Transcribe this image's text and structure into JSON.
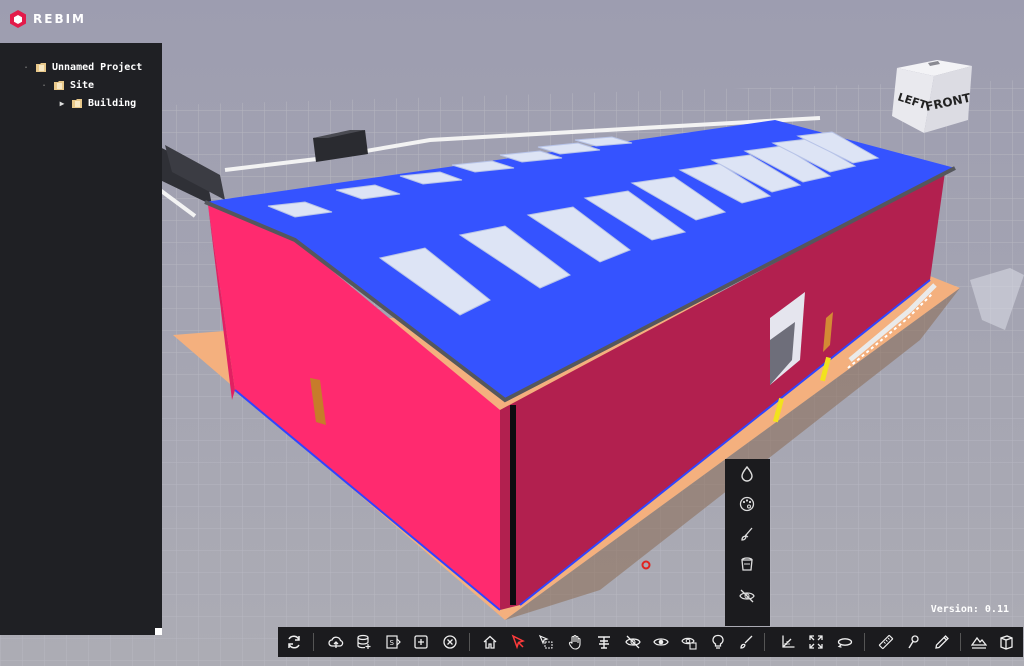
{
  "app": {
    "logo_text": "REBIM"
  },
  "project_tree": {
    "nodes": [
      {
        "label": "Unnamed Project",
        "level": 0,
        "expanded": true
      },
      {
        "label": "Site",
        "level": 1,
        "expanded": true
      },
      {
        "label": "Building",
        "level": 2,
        "expanded": false
      }
    ]
  },
  "nav_cube": {
    "left_face": "LEFT",
    "front_face": "FRONT"
  },
  "version_text": "Version: 0.11",
  "popup_menu": {
    "items": [
      "water-drop-icon",
      "palette-icon",
      "brush-icon",
      "paint-bucket-icon",
      "eye-off-icon"
    ]
  },
  "toolbar": {
    "buttons": [
      "refresh-icon",
      "cloud-upload-icon",
      "database-add-icon",
      "step-file-icon",
      "add-square-icon",
      "close-circle-icon",
      "home-icon",
      "select-arrow-icon",
      "box-select-icon",
      "pan-hand-icon",
      "section-plane-icon",
      "hide-icon",
      "show-icon",
      "isolate-icon",
      "light-bulb-icon",
      "paint-brush-icon",
      "axes-icon",
      "fit-view-icon",
      "orbit-icon",
      "measure-ruler-icon",
      "pin-icon",
      "pencil-icon",
      "terrain-icon",
      "cube-icon"
    ]
  },
  "colors": {
    "roof": "#3553ff",
    "walls": "#ff2670",
    "slab": "#f4b07e",
    "background": "#a8a8b3",
    "panel": "#1f2024"
  }
}
